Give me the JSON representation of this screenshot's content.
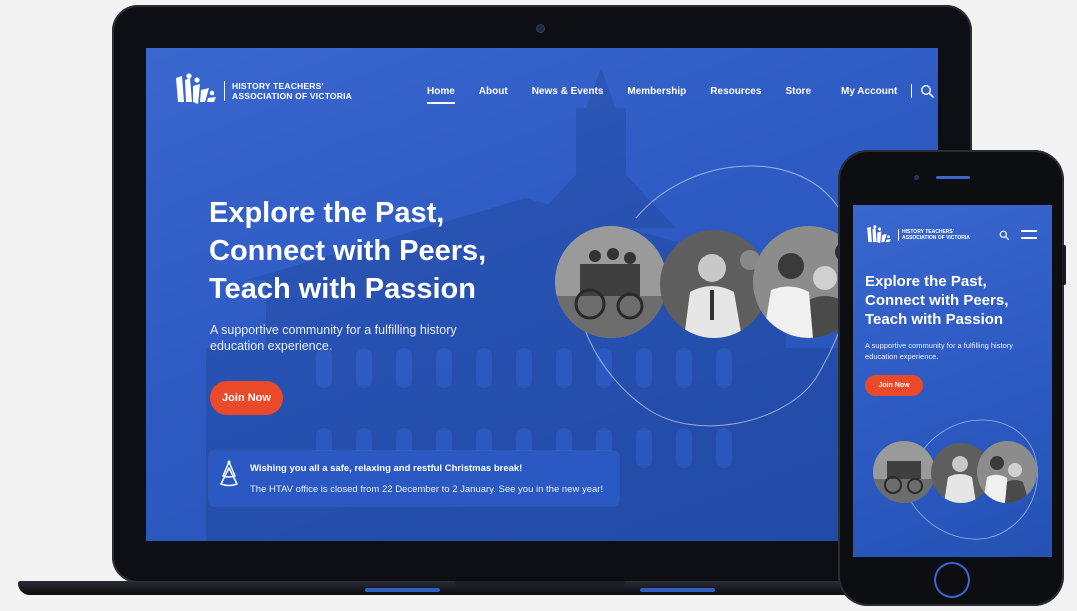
{
  "desktop": {
    "logo": {
      "line1": "HISTORY TEACHERS'",
      "line2": "ASSOCIATION OF VICTORIA"
    },
    "nav": [
      {
        "label": "Home",
        "active": true
      },
      {
        "label": "About"
      },
      {
        "label": "News & Events"
      },
      {
        "label": "Membership"
      },
      {
        "label": "Resources"
      },
      {
        "label": "Store"
      },
      {
        "label": "My Account"
      }
    ],
    "hero": {
      "title_line1": "Explore the Past,",
      "title_line2": "Connect with Peers,",
      "title_line3": "Teach with Passion",
      "subtitle": "A supportive community for a fulfilling history education experience.",
      "cta": "Join Now"
    },
    "notice": {
      "icon": "christmas-tree-icon",
      "title": "Wishing you all a safe, relaxing and restful Christmas break!",
      "body": "The HTAV office is closed from 22 December to 2 January. See you in the new year!"
    }
  },
  "mobile": {
    "logo": {
      "line1": "HISTORY TEACHERS'",
      "line2": "ASSOCIATION OF VICTORIA"
    },
    "hero": {
      "title_line1": "Explore the Past,",
      "title_line2": "Connect with Peers,",
      "title_line3": "Teach with Passion",
      "subtitle": "A supportive community for a fulfilling history education experience.",
      "cta": "Join Now"
    }
  },
  "colors": {
    "brand_blue": "#2e5bc3",
    "accent_orange": "#ea4a2a",
    "text_white": "#ffffff"
  }
}
